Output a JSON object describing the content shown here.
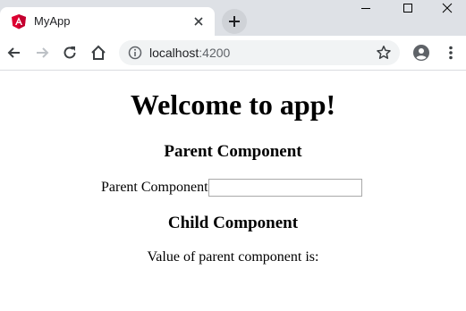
{
  "browser": {
    "tab": {
      "title": "MyApp",
      "favicon": "angular-logo-icon"
    },
    "address": {
      "host": "localhost",
      "port": ":4200"
    },
    "colors": {
      "tabstrip": "#dee1e6",
      "favicon": "#dd0031"
    }
  },
  "page": {
    "heading": "Welcome to app!",
    "parent_heading": "Parent Component",
    "parent_label": "Parent Component",
    "parent_input_value": "",
    "child_heading": "Child Component",
    "child_text": "Value of parent component is:"
  }
}
